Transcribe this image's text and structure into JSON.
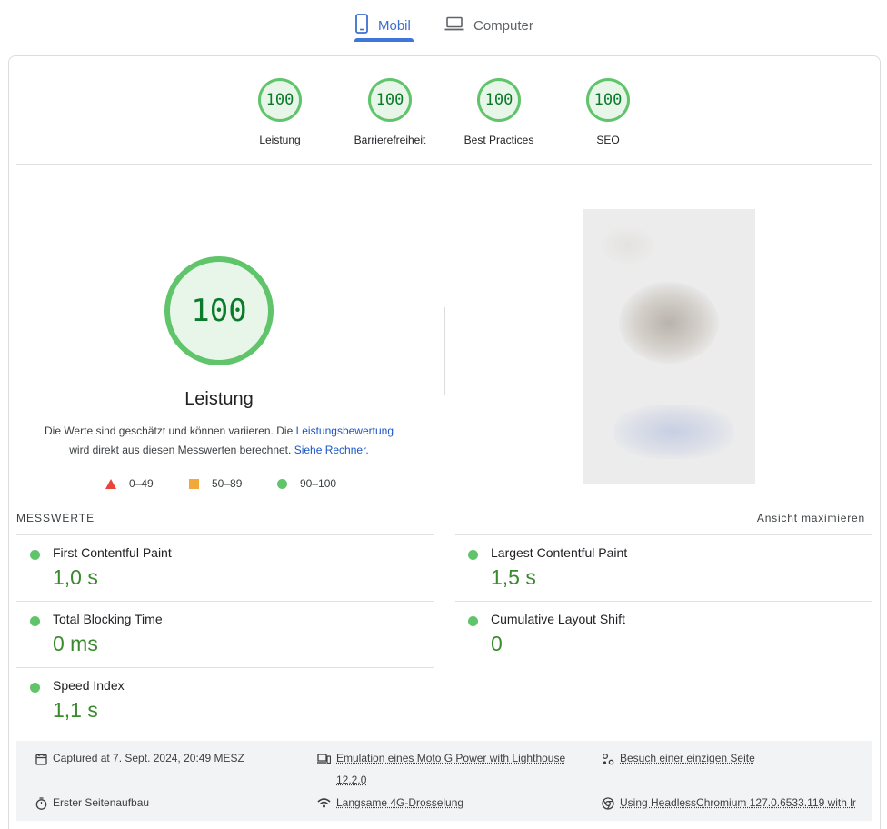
{
  "device_tabs": {
    "mobile_label": "Mobil",
    "desktop_label": "Computer",
    "active": "Mobil"
  },
  "categories": [
    {
      "score": "100",
      "label": "Leistung"
    },
    {
      "score": "100",
      "label": "Barrierefreiheit"
    },
    {
      "score": "100",
      "label": "Best Practices"
    },
    {
      "score": "100",
      "label": "SEO"
    }
  ],
  "performance": {
    "score": "100",
    "title": "Leistung",
    "desc_part1": "Die Werte sind geschätzt und können variieren. Die ",
    "desc_link1": "Leistungsbewertung",
    "desc_part2": "wird direkt aus diesen Messwerten berechnet. ",
    "desc_link2": "Siehe Rechner."
  },
  "legend": {
    "poor": "0–49",
    "average": "50–89",
    "good": "90–100"
  },
  "metrics": {
    "heading": "MESSWERTE",
    "expand_label": "Ansicht maximieren",
    "items": [
      {
        "name": "First Contentful Paint",
        "value": "1,0 s"
      },
      {
        "name": "Largest Contentful Paint",
        "value": "1,5 s"
      },
      {
        "name": "Total Blocking Time",
        "value": "0 ms"
      },
      {
        "name": "Cumulative Layout Shift",
        "value": "0"
      },
      {
        "name": "Speed Index",
        "value": "1,1 s"
      }
    ]
  },
  "run_info": {
    "captured": "Captured at 7. Sept. 2024, 20:49 MESZ",
    "emulation_line1": "Emulation eines Moto G Power with Lighthouse",
    "emulation_line2": "12.2.0",
    "session": "Besuch einer einzigen Seite",
    "load": "Erster Seitenaufbau",
    "throttling": "Langsame 4G-Drosselung",
    "browser": "Using HeadlessChromium 127.0.6533.119 with lr"
  },
  "colors": {
    "pass": "#5fc46a",
    "pass_text": "#3a8a2e",
    "average": "#f0a93a",
    "fail": "#e8453c",
    "accent": "#3c6fcf"
  }
}
